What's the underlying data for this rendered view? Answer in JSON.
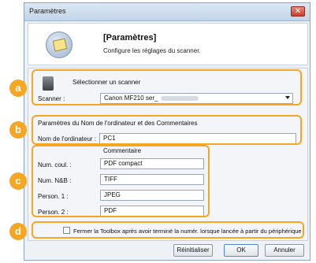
{
  "window": {
    "title": "Paramètres",
    "close_glyph": "✕"
  },
  "header": {
    "title": "[Paramètres]",
    "subtitle": "Configure les réglages du scanner.",
    "icon": "scanner-settings-icon"
  },
  "callouts": [
    "a",
    "b",
    "c",
    "d"
  ],
  "section_a": {
    "heading": "Sélectionner un scanner",
    "scanner_label": "Scanner :",
    "scanner_value": "Canon MF210 ser_"
  },
  "section_b": {
    "heading": "Paramètres du Nom de l'ordinateur et des Commentaires",
    "computer_name_label": "Nom de l'ordinateur :",
    "computer_name_value": "PC1"
  },
  "section_c": {
    "heading": "Commentaire",
    "rows": [
      {
        "label": "Num. coul. :",
        "value": "PDF compact"
      },
      {
        "label": "Num. N&B :",
        "value": "TIFF"
      },
      {
        "label": "Person. 1 :",
        "value": "JPEG"
      },
      {
        "label": "Person. 2 :",
        "value": "PDF"
      }
    ]
  },
  "section_d": {
    "checkbox_label": "Fermer la Toolbox après avoir terminé la numér. lorsque lancée à partir du périphérique",
    "checked": false
  },
  "buttons": {
    "reset": "Réinitialiser",
    "ok": "OK",
    "cancel": "Annuler"
  },
  "colors": {
    "callout": "#f5a623",
    "title_bar": "#c3d5ea",
    "dialog_bg": "#eef2f7"
  }
}
